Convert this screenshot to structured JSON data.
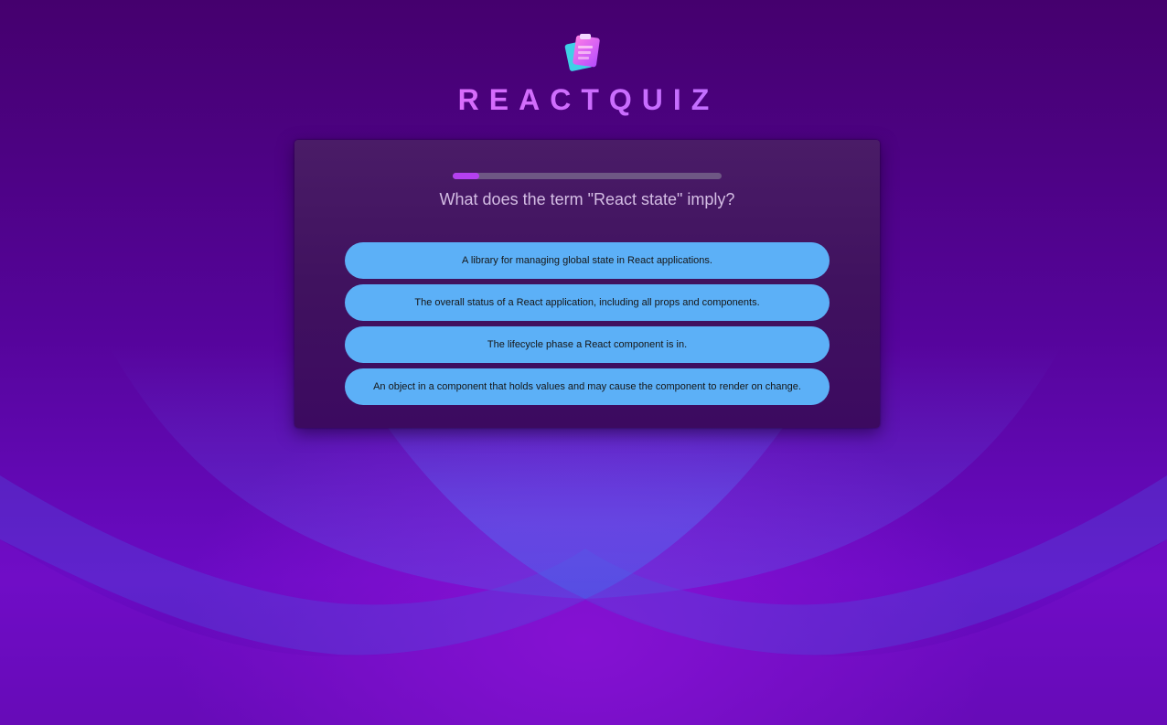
{
  "app": {
    "logo_icon": "clipboard-quiz-icon",
    "title": "REACTQUIZ"
  },
  "quiz": {
    "progress": 0.1,
    "question": "What does the term \"React state\" imply?",
    "answers": [
      "A library for managing global state in React applications.",
      "The overall status of a React application, including all props and components.",
      "The lifecycle phase a React component is in.",
      "An object in a component that holds values and may cause the component to render on change."
    ]
  },
  "colors": {
    "accent": "#b440f0",
    "answer_bg": "#5cb0f7",
    "title_gradient_start": "#ff6bf0",
    "title_gradient_end": "#a57bff"
  }
}
